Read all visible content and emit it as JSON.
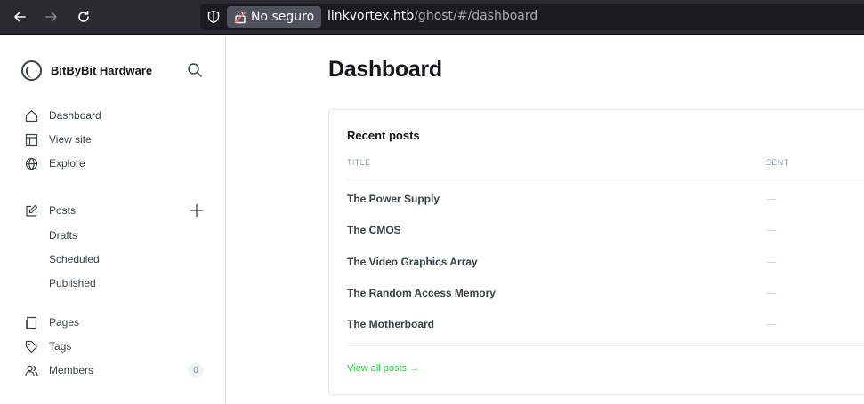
{
  "browser": {
    "security_label": "No seguro",
    "url_host": "linkvortex.htb",
    "url_path": "/ghost/#/dashboard"
  },
  "sidebar": {
    "brand": "BitByBit Hardware",
    "primary": [
      {
        "label": "Dashboard",
        "icon": "home-icon"
      },
      {
        "label": "View site",
        "icon": "layout-icon"
      },
      {
        "label": "Explore",
        "icon": "globe-icon"
      }
    ],
    "posts": {
      "label": "Posts",
      "icon": "edit-icon",
      "sub": [
        "Drafts",
        "Scheduled",
        "Published"
      ]
    },
    "secondary": [
      {
        "label": "Pages",
        "icon": "pages-icon"
      },
      {
        "label": "Tags",
        "icon": "tag-icon"
      },
      {
        "label": "Members",
        "icon": "members-icon",
        "count": "0"
      }
    ]
  },
  "main": {
    "title": "Dashboard",
    "recent_posts": {
      "heading": "Recent posts",
      "col_title": "TITLE",
      "col_sent": "SENT",
      "rows": [
        {
          "title": "The Power Supply",
          "sent": "—"
        },
        {
          "title": "The CMOS",
          "sent": "—"
        },
        {
          "title": "The Video Graphics Array",
          "sent": "—"
        },
        {
          "title": "The Random Access Memory",
          "sent": "—"
        },
        {
          "title": "The Motherboard",
          "sent": "—"
        }
      ],
      "view_all": "View all posts →"
    }
  },
  "colors": {
    "accent_green": "#30cf43",
    "browser_chrome": "#2b2a33"
  }
}
